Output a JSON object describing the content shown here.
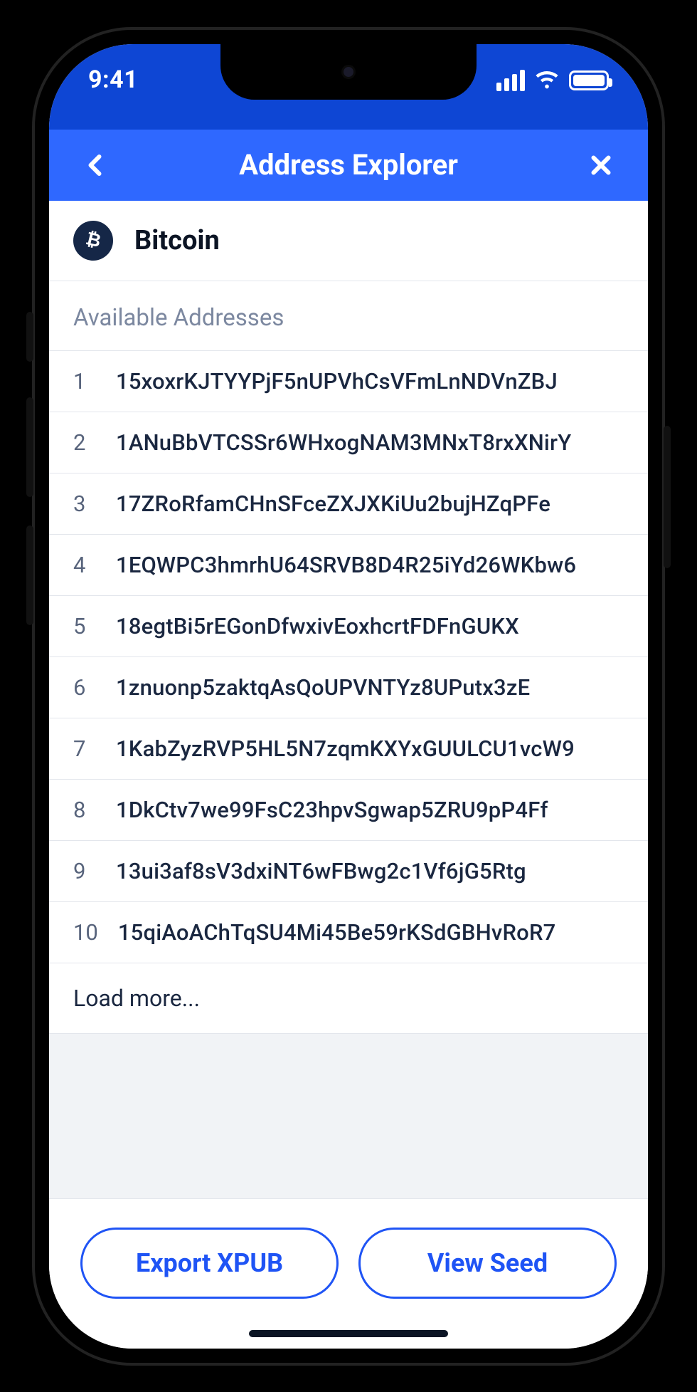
{
  "statusbar": {
    "time": "9:41"
  },
  "navbar": {
    "title": "Address Explorer"
  },
  "coin": {
    "name": "Bitcoin",
    "icon": "bitcoin-icon"
  },
  "section": {
    "heading": "Available Addresses"
  },
  "addresses": [
    {
      "index": "1",
      "address": "15xoxrKJTYYPjF5nUPVhCsVFmLnNDVnZBJ"
    },
    {
      "index": "2",
      "address": "1ANuBbVTCSSr6WHxogNAM3MNxT8rxXNirY"
    },
    {
      "index": "3",
      "address": "17ZRoRfamCHnSFceZXJXKiUu2bujHZqPFe"
    },
    {
      "index": "4",
      "address": "1EQWPC3hmrhU64SRVB8D4R25iYd26WKbw6"
    },
    {
      "index": "5",
      "address": "18egtBi5rEGonDfwxivEoxhcrtFDFnGUKX"
    },
    {
      "index": "6",
      "address": "1znuonp5zaktqAsQoUPVNTYz8UPutx3zE"
    },
    {
      "index": "7",
      "address": "1KabZyzRVP5HL5N7zqmKXYxGUULCU1vcW9"
    },
    {
      "index": "8",
      "address": "1DkCtv7we99FsC23hpvSgwap5ZRU9pP4Ff"
    },
    {
      "index": "9",
      "address": "13ui3af8sV3dxiNT6wFBwg2c1Vf6jG5Rtg"
    },
    {
      "index": "10",
      "address": "15qiAoAChTqSU4Mi45Be59rKSdGBHvRoR7"
    }
  ],
  "load_more_label": "Load more...",
  "actions": {
    "export_xpub": "Export XPUB",
    "view_seed": "View Seed"
  },
  "colors": {
    "status_bg": "#0E46D4",
    "nav_bg": "#2F68FF",
    "accent": "#1F54F5",
    "muted": "#7C88A0",
    "border": "#E3E6EC",
    "text_dark": "#1A2740"
  }
}
